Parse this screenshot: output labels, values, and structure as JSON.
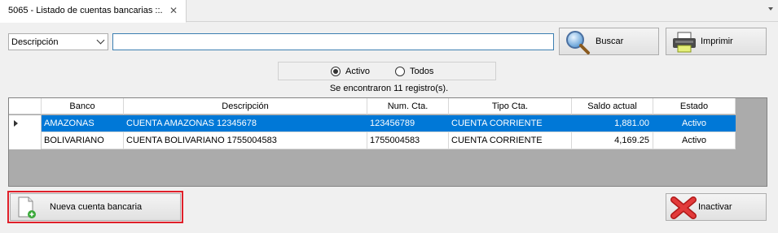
{
  "tab": {
    "title": "5065 - Listado de cuentas bancarias ::.",
    "close": "✕"
  },
  "filter": {
    "field": "Descripción",
    "search_value": ""
  },
  "buttons": {
    "buscar": "Buscar",
    "imprimir": "Imprimir",
    "nueva": "Nueva cuenta bancaria",
    "inactivar": "Inactivar"
  },
  "status_filter": {
    "options": [
      "Activo",
      "Todos"
    ],
    "selected": "Activo"
  },
  "result_count": "Se encontraron 11 registro(s).",
  "grid": {
    "columns": [
      "Banco",
      "Descripción",
      "Num. Cta.",
      "Tipo Cta.",
      "Saldo actual",
      "Estado"
    ],
    "rows": [
      [
        "AMAZONAS",
        "CUENTA AMAZONAS 12345678",
        "123456789",
        "CUENTA CORRIENTE",
        "1,881.00",
        "Activo"
      ],
      [
        "BOLIVARIANO",
        "CUENTA BOLIVARIANO 1755004583",
        "1755004583",
        "CUENTA CORRIENTE",
        "4,169.25",
        "Activo"
      ]
    ],
    "selected_row": 0
  },
  "colors": {
    "selection": "#0078d7",
    "highlight": "#e0202a",
    "grid_bg": "#ababab"
  }
}
